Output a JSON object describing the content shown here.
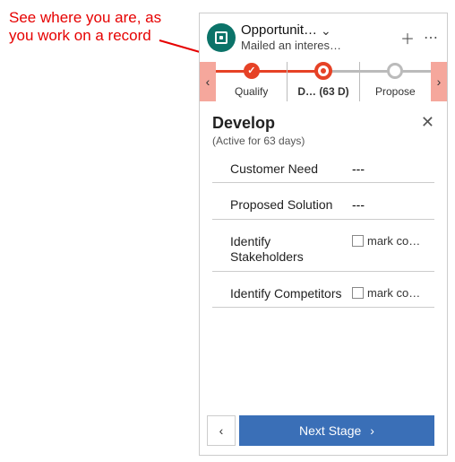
{
  "annotation": "See where you are, as you work on a record",
  "header": {
    "title": "Opportunit…",
    "subtitle": "Mailed an interes…"
  },
  "stages": [
    {
      "label": "Qualify",
      "state": "done"
    },
    {
      "label": "D…  (63 D)",
      "state": "current"
    },
    {
      "label": "Propose",
      "state": "future"
    }
  ],
  "detail": {
    "title": "Develop",
    "subtitle": "(Active for 63 days)"
  },
  "fields": {
    "customerNeed": {
      "label": "Customer Need",
      "value": "---"
    },
    "proposedSolution": {
      "label": "Proposed Solution",
      "value": "---"
    },
    "identifyStakeholders": {
      "label": "Identify Stakeholders",
      "check": "mark co…"
    },
    "identifyCompetitors": {
      "label": "Identify Competitors",
      "check": "mark co…"
    }
  },
  "footer": {
    "next": "Next Stage"
  }
}
